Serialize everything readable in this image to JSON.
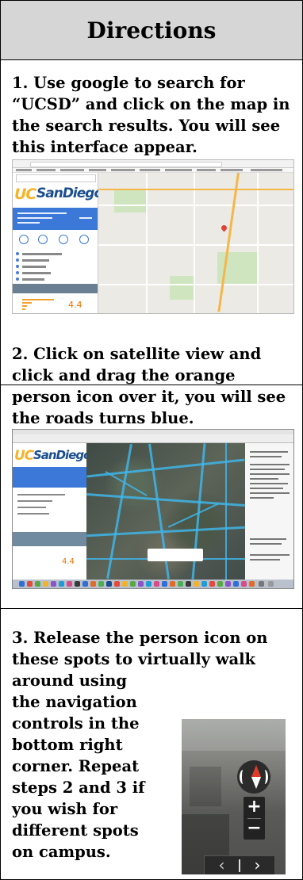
{
  "header": {
    "title": "Directions"
  },
  "steps": [
    {
      "lines": [
        "1. Use google to search for",
        "“UCSD” and click on the map in",
        "the search results.  You will see",
        "this interface appear."
      ]
    },
    {
      "lines": [
        "2. Click on satellite view and",
        "click and drag the orange",
        "person icon over it, you will see",
        "the roads turns blue."
      ]
    },
    {
      "lines": [
        "3. Release the person icon on",
        "these spots to virtually walk",
        "around using",
        "the navigation",
        "controls in the",
        "bottom right",
        "corner. Repeat",
        "steps 2 and 3 if",
        "you wish for",
        "different spots",
        "on campus."
      ]
    }
  ],
  "screenshot1": {
    "logo_uc": "UC",
    "logo_sd": "SanDiego",
    "rating": "4.4"
  },
  "screenshot2": {
    "logo_uc": "UC",
    "logo_sd": "SanDiego",
    "rating": "4.4"
  },
  "screenshot3": {
    "zoom_in": "+",
    "zoom_out": "−",
    "prev_arrow": "‹",
    "next_arrow": "›"
  },
  "colors": {
    "header_bg": "#d6d6d6",
    "street_view_blue": "#3fb5e8",
    "brand_gold": "#f5b428",
    "brand_blue": "#1b4e8f"
  }
}
